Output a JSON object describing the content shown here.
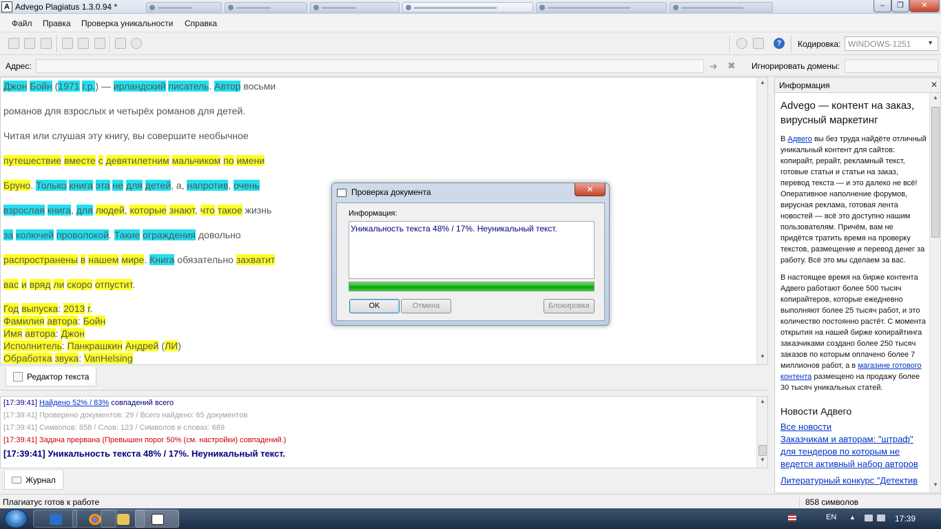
{
  "window": {
    "title": "Advego Plagiatus 1.3.0.94 *",
    "app_icon_letter": "A",
    "controls": {
      "minimize": "–",
      "maximize": "❐",
      "close": "✕"
    }
  },
  "menu": {
    "items": [
      "Файл",
      "Правка",
      "Проверка уникальности",
      "Справка"
    ]
  },
  "toolbar": {
    "encoding_label": "Кодировка:",
    "encoding_value": "WINDOWS-1251",
    "help_glyph": "?"
  },
  "address": {
    "label": "Адрес:",
    "value": "",
    "ignore_label": "Игнорировать домены:",
    "ignore_value": ""
  },
  "editor": {
    "paragraphs": [
      [
        [
          "Джон",
          "c"
        ],
        [
          " ",
          ""
        ],
        [
          "Бойн",
          "c"
        ],
        [
          " (",
          ""
        ],
        [
          "1971",
          "c"
        ],
        [
          " ",
          ""
        ],
        [
          "г.р.",
          "c"
        ],
        [
          ") — ",
          ""
        ],
        [
          "ирландский",
          "c"
        ],
        [
          " ",
          ""
        ],
        [
          "писатель",
          "c"
        ],
        [
          ". ",
          ""
        ],
        [
          "Автор",
          "c"
        ],
        [
          " восьми",
          ""
        ]
      ],
      [
        [
          "романов для взрослых и четырёх романов для детей.",
          ""
        ]
      ],
      [
        [
          "Читая или слушая эту книгу, вы совершите необычное",
          ""
        ]
      ],
      [
        [
          "путешествие",
          "y"
        ],
        [
          " ",
          ""
        ],
        [
          "вместе",
          "y"
        ],
        [
          " ",
          ""
        ],
        [
          "с",
          "y"
        ],
        [
          " ",
          ""
        ],
        [
          "девятилетним",
          "y"
        ],
        [
          " ",
          ""
        ],
        [
          "мальчиком",
          "y"
        ],
        [
          " ",
          ""
        ],
        [
          "по",
          "y"
        ],
        [
          " ",
          ""
        ],
        [
          "имени",
          "y"
        ]
      ],
      [
        [
          "Бруно",
          "y"
        ],
        [
          ". ",
          ""
        ],
        [
          "Только",
          "c"
        ],
        [
          " ",
          ""
        ],
        [
          "книга",
          "c"
        ],
        [
          " ",
          ""
        ],
        [
          "эта",
          "c"
        ],
        [
          " ",
          ""
        ],
        [
          "не",
          "c"
        ],
        [
          " ",
          ""
        ],
        [
          "для",
          "c"
        ],
        [
          " ",
          ""
        ],
        [
          "детей",
          "c"
        ],
        [
          ", а, ",
          ""
        ],
        [
          "напротив",
          "c"
        ],
        [
          ", ",
          ""
        ],
        [
          "очень",
          "c"
        ]
      ],
      [
        [
          "взрослая",
          "c"
        ],
        [
          " ",
          ""
        ],
        [
          "книга",
          "c"
        ],
        [
          ", ",
          ""
        ],
        [
          "для",
          "c"
        ],
        [
          " ",
          ""
        ],
        [
          "людей",
          "y"
        ],
        [
          ", ",
          ""
        ],
        [
          "которые",
          "y"
        ],
        [
          " ",
          ""
        ],
        [
          "знают",
          "y"
        ],
        [
          ", ",
          ""
        ],
        [
          "что",
          "y"
        ],
        [
          " ",
          ""
        ],
        [
          "такое",
          "y"
        ],
        [
          " жизнь",
          ""
        ]
      ],
      [
        [
          "за",
          "c"
        ],
        [
          " ",
          ""
        ],
        [
          "колючей",
          "c"
        ],
        [
          " ",
          ""
        ],
        [
          "проволокой",
          "c"
        ],
        [
          ". ",
          ""
        ],
        [
          "Такие",
          "c"
        ],
        [
          " ",
          ""
        ],
        [
          "ограждения",
          "c"
        ],
        [
          " довольно",
          ""
        ]
      ],
      [
        [
          "распространены",
          "y"
        ],
        [
          " ",
          ""
        ],
        [
          "в",
          "y"
        ],
        [
          " ",
          ""
        ],
        [
          "нашем",
          "y"
        ],
        [
          " ",
          ""
        ],
        [
          "мире",
          "y"
        ],
        [
          ". ",
          ""
        ],
        [
          "Книга",
          "c"
        ],
        [
          " обязательно ",
          ""
        ],
        [
          "захватит",
          "y"
        ]
      ],
      [
        [
          "вас",
          "y"
        ],
        [
          " ",
          ""
        ],
        [
          "и",
          "y"
        ],
        [
          " ",
          ""
        ],
        [
          "вряд",
          "y"
        ],
        [
          " ",
          ""
        ],
        [
          "ли",
          "y"
        ],
        [
          " ",
          ""
        ],
        [
          "скоро",
          "y"
        ],
        [
          " ",
          ""
        ],
        [
          "отпустит",
          "y"
        ],
        [
          ".",
          ""
        ]
      ]
    ],
    "lines": [
      [
        [
          "Год",
          "y"
        ],
        [
          " ",
          ""
        ],
        [
          "выпуска",
          "y"
        ],
        [
          ": ",
          ""
        ],
        [
          "2013",
          "y"
        ],
        [
          " ",
          ""
        ],
        [
          "г",
          "y"
        ],
        [
          ".",
          ""
        ]
      ],
      [
        [
          "Фамилия",
          "y"
        ],
        [
          " ",
          ""
        ],
        [
          "автора",
          "y"
        ],
        [
          ": ",
          ""
        ],
        [
          "Бойн",
          "y"
        ]
      ],
      [
        [
          "Имя",
          "y"
        ],
        [
          " ",
          ""
        ],
        [
          "автора",
          "y"
        ],
        [
          ": ",
          ""
        ],
        [
          "Джон",
          "y"
        ]
      ],
      [
        [
          "Исполнитель",
          "y"
        ],
        [
          ": ",
          ""
        ],
        [
          "Панкрашкин",
          "y"
        ],
        [
          " ",
          ""
        ],
        [
          "Андрей",
          "y"
        ],
        [
          " (",
          ""
        ],
        [
          "ЛИ",
          "y"
        ],
        [
          ")",
          ""
        ]
      ],
      [
        [
          "Обработка",
          "y"
        ],
        [
          " ",
          ""
        ],
        [
          "звука",
          "y"
        ],
        [
          ": ",
          ""
        ],
        [
          "VanHelsing",
          "y"
        ]
      ]
    ],
    "tab_label": "Редактор текста"
  },
  "log": {
    "lines": [
      {
        "time": "[17:39:41]",
        "link": "Найдено 52% / 83%",
        "text": " совпадений всего",
        "color": "#000080",
        "bold": false
      },
      {
        "time": "[17:39:41]",
        "link": "",
        "text": " Проверено документов: 29   /  Всего найдено: 65 документов",
        "color": "#a0a0a0",
        "bold": false
      },
      {
        "time": "[17:39:41]",
        "link": "",
        "text": " Символов: 858  /  Слов: 123  /  Символов в словах: 689",
        "color": "#a0a0a0",
        "bold": false
      },
      {
        "time": "[17:39:41]",
        "link": "",
        "text": " Задача прервана (Превышен порог 50% (см. настройки) совпадений.)",
        "color": "#cc0000",
        "bold": false
      },
      {
        "time": "[17:39:41]",
        "link": "",
        "text": " Уникальность текста 48% / 17%. Неуникальный текст.",
        "color": "#000080",
        "bold": true
      }
    ],
    "tab_label": "Журнал"
  },
  "status": {
    "text": "Плагиатус готов к работе",
    "chars": "858 символов"
  },
  "info_panel": {
    "header": "Информация",
    "close_glyph": "✕",
    "title": "Advego — контент на заказ, вирусный маркетинг",
    "p1_before": "В ",
    "p1_link": "Адвего",
    "p1_after": " вы без труда найдёте отличный уникальный контент для сайтов: копирайт, рерайт, рекламный текст, готовые статьи и статьи на заказ, перевод текста — и это далеко не всё! Оперативное наполнение форумов, вирусная реклама, готовая лента новостей — всё это доступно нашим пользователям. Причём, вам не придётся тратить время на проверку текстов, размещение и перевод денег за работу. Всё это мы сделаем за вас.",
    "p2_before": "В настоящее время на бирже контента Адвего работают более 500 тысяч копирайтеров, которые ежедневно выполняют более 25 тысяч работ, и это количество постоянно растёт. С момента открытия на нашей бирже копирайтинга заказчиками создано более 250 тысяч заказов по которым оплачено более 7 миллионов работ, а в ",
    "p2_link": "магазине готового контента",
    "p2_after": " размещено на продажу более 30 тысяч уникальных статей.",
    "news_title": "Новости Адвего",
    "news": [
      "Все новости",
      "Заказчикам и авторам: \"штраф\" для тендеров по которым не ведется активный набор авторов",
      "Литературный конкурс \"Детектив"
    ]
  },
  "dialog": {
    "title": "Проверка документа",
    "close_glyph": "✕",
    "info_label": "Информация:",
    "message": "Уникальность текста 48% / 17%. Неуникальный текст.",
    "progress": 1.0,
    "ok_label": "OK",
    "cancel_label": "Отмена",
    "block_label": "Блокировки"
  },
  "taskbar": {
    "lang": "EN",
    "clock": "17:39"
  }
}
